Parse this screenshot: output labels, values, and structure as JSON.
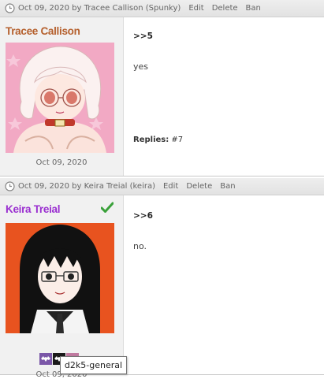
{
  "posts": [
    {
      "meta": "Oct 09, 2020 by Tracee Callison (Spunky)",
      "actions": {
        "edit": "Edit",
        "delete": "Delete",
        "ban": "Ban"
      },
      "poster": {
        "name": "Tracee Callison",
        "name_color": "#b5602d",
        "date": "Oct 09, 2020"
      },
      "number": ">>5",
      "body": "yes",
      "replies_label": "Replies:",
      "replies_value": "#7"
    },
    {
      "meta": "Oct 09, 2020 by Keira Treial (keira)",
      "actions": {
        "edit": "Edit",
        "delete": "Delete",
        "ban": "Ban"
      },
      "poster": {
        "name": "Keira Treial",
        "name_color": "#9a2fd0",
        "date": "Oct 09, 2020",
        "verified_icon": "check-icon"
      },
      "badges": [
        {
          "icon": "bat-icon",
          "color": "#7b57a8"
        },
        {
          "icon": "bat-icon",
          "color": "#1a1a1a"
        },
        {
          "icon": "bat-icon",
          "color": "#c07aa0"
        }
      ],
      "number": ">>6",
      "body": "no."
    }
  ],
  "tooltip": "d2k5-general"
}
